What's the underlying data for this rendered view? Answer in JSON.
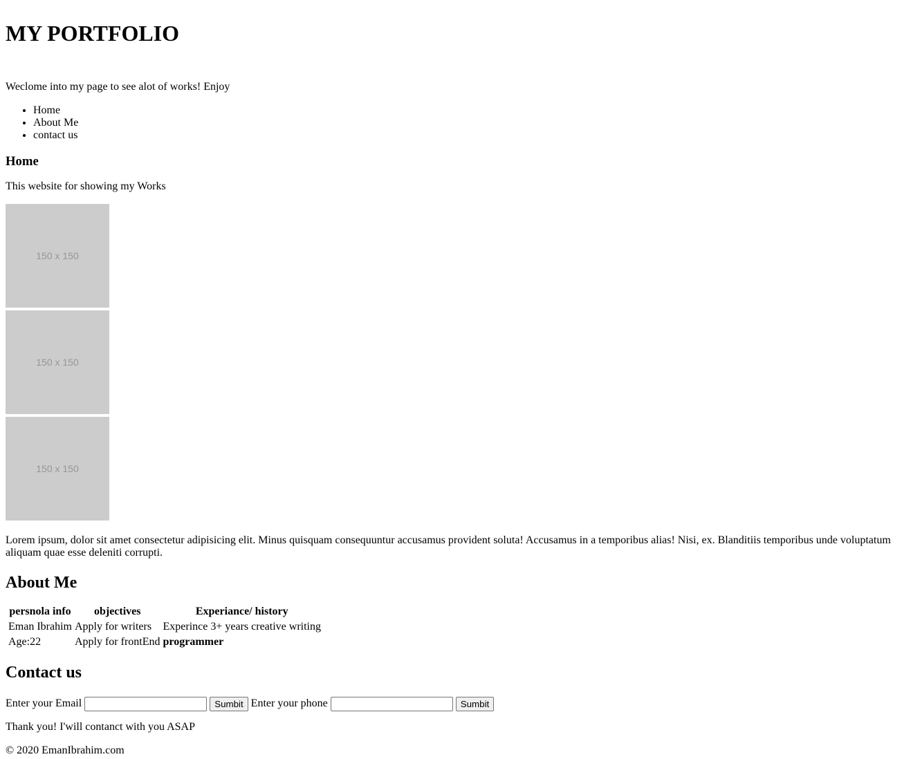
{
  "header": {
    "title": "MY PORTFOLIO",
    "tagline": "Weclome into my page to see alot of works! Enjoy"
  },
  "nav": {
    "items": [
      {
        "label": "Home"
      },
      {
        "label": "About Me"
      },
      {
        "label": "contact us"
      }
    ]
  },
  "home": {
    "heading": "Home",
    "description": "This website for showing my Works",
    "images": [
      {
        "label": "150 x 150"
      },
      {
        "label": "150 x 150"
      },
      {
        "label": "150 x 150"
      }
    ],
    "lorem": "Lorem ipsum, dolor sit amet consectetur adipisicing elit. Minus quisquam consequuntur accusamus provident soluta! Accusamus in a temporibus alias! Nisi, ex. Blanditiis temporibus unde voluptatum aliquam quae esse deleniti corrupti."
  },
  "about": {
    "heading": "About Me",
    "headers": [
      "persnola info",
      "objectives",
      "Experiance/ history"
    ],
    "rows": [
      [
        "Eman Ibrahim",
        "Apply for writers",
        "Experince 3+ years creative writing"
      ],
      [
        "Age:22",
        "Apply for frontEnd",
        "programmer"
      ]
    ]
  },
  "contact": {
    "heading": "Contact us",
    "email_label": "Enter your Email",
    "email_value": "",
    "email_submit": "Sumbit",
    "phone_label": "Enter your phone",
    "phone_value": "",
    "phone_submit": "Sumbit",
    "thanks": "Thank you! I'will contanct with you ASAP"
  },
  "footer": {
    "text": "© 2020 EmanIbrahim.com"
  }
}
